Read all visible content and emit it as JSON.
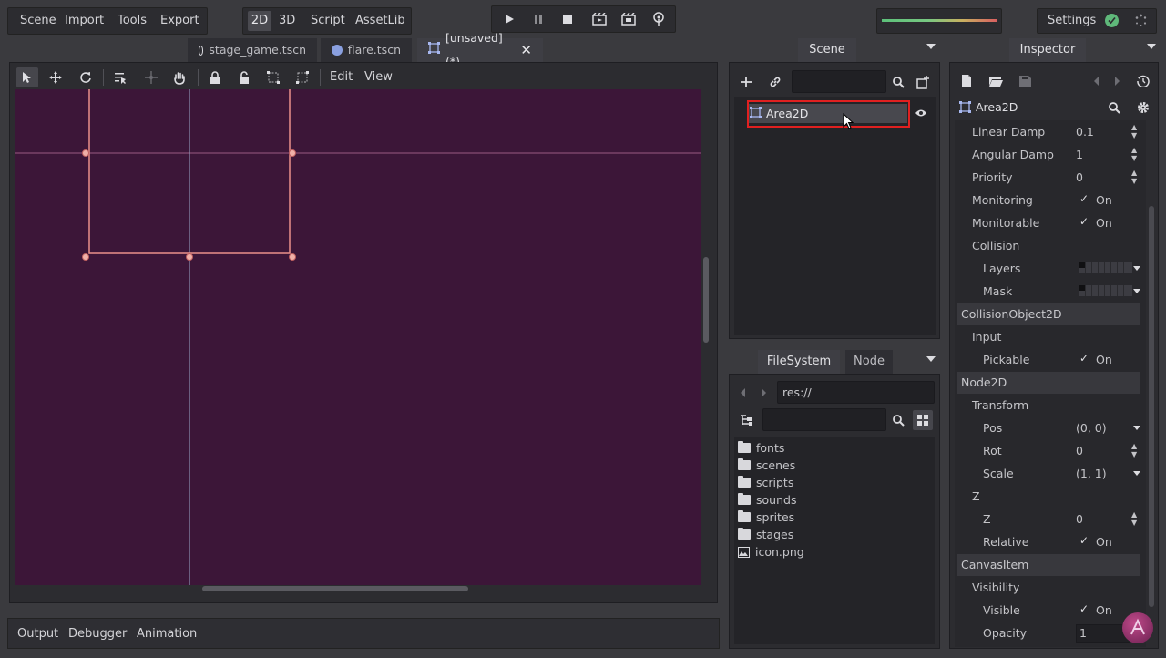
{
  "menu": {
    "scene": "Scene",
    "import": "Import",
    "tools": "Tools",
    "export": "Export"
  },
  "modes": {
    "two_d": "2D",
    "three_d": "3D",
    "script": "Script",
    "assetlib": "AssetLib"
  },
  "settings_label": "Settings",
  "tabs": [
    {
      "label": "stage_game.tscn"
    },
    {
      "label": "flare.tscn"
    },
    {
      "label": "[unsaved](*)"
    }
  ],
  "toolbar": {
    "edit": "Edit",
    "view": "View"
  },
  "scene_dock": {
    "title": "Scene",
    "node_name": "Area2D"
  },
  "filesystem": {
    "tab_filesystem": "FileSystem",
    "tab_node": "Node",
    "path": "res://",
    "items": [
      {
        "name": "fonts",
        "type": "folder"
      },
      {
        "name": "scenes",
        "type": "folder"
      },
      {
        "name": "scripts",
        "type": "folder"
      },
      {
        "name": "sounds",
        "type": "folder"
      },
      {
        "name": "sprites",
        "type": "folder"
      },
      {
        "name": "stages",
        "type": "folder"
      },
      {
        "name": "icon.png",
        "type": "image"
      }
    ]
  },
  "inspector": {
    "title": "Inspector",
    "node_name": "Area2D",
    "linear_damp_label": "Linear Damp",
    "linear_damp_value": "0.1",
    "angular_damp_label": "Angular Damp",
    "angular_damp_value": "1",
    "priority_label": "Priority",
    "priority_value": "0",
    "monitoring_label": "Monitoring",
    "monitoring_value": "On",
    "monitorable_label": "Monitorable",
    "monitorable_value": "On",
    "collision_label": "Collision",
    "layers_label": "Layers",
    "mask_label": "Mask",
    "section_collisionobject": "CollisionObject2D",
    "input_label": "Input",
    "pickable_label": "Pickable",
    "pickable_value": "On",
    "section_node2d": "Node2D",
    "transform_label": "Transform",
    "pos_label": "Pos",
    "pos_value": "(0, 0)",
    "rot_label": "Rot",
    "rot_value": "0",
    "scale_label": "Scale",
    "scale_value": "(1, 1)",
    "z_group_label": "Z",
    "z_label": "Z",
    "z_value": "0",
    "relative_label": "Relative",
    "relative_value": "On",
    "section_canvasitem": "CanvasItem",
    "visibility_label": "Visibility",
    "visible_label": "Visible",
    "visible_value": "On",
    "opacity_label": "Opacity",
    "opacity_value": "1"
  },
  "bottom": {
    "output": "Output",
    "debugger": "Debugger",
    "animation": "Animation"
  },
  "colors": {
    "viewport_bg": "#3c1638",
    "selection_outline": "#e08a86",
    "highlight_red": "#e02020"
  }
}
